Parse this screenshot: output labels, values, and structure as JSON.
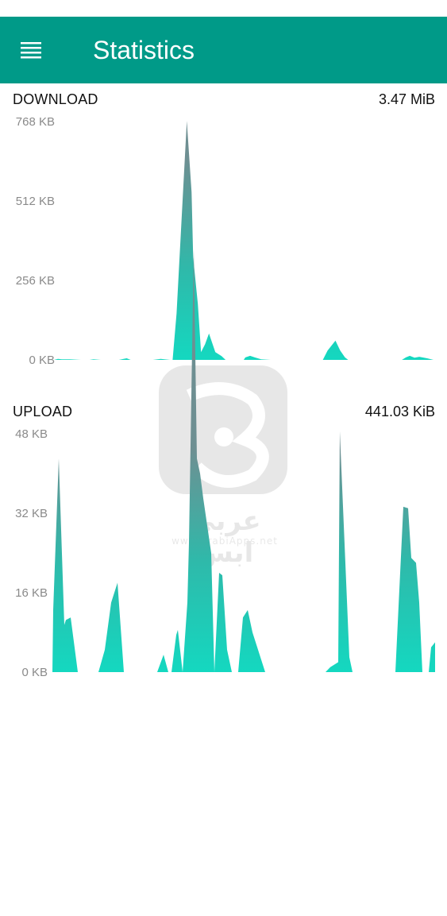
{
  "header": {
    "title": "Statistics",
    "menu_icon": "hamburger-menu-icon",
    "background": "#009a88"
  },
  "download": {
    "label": "DOWNLOAD",
    "total": "3.47 MiB",
    "y_ticks": [
      "768 KB",
      "512 KB",
      "256 KB",
      "0 KB"
    ]
  },
  "upload": {
    "label": "UPLOAD",
    "total": "441.03 KiB",
    "y_ticks": [
      "48 KB",
      "32 KB",
      "16 KB",
      "0 KB"
    ]
  },
  "watermark": {
    "text": "عربي ابس",
    "url": "www.ArabiApps.net"
  },
  "chart_data": [
    {
      "type": "area",
      "name_ref": "download",
      "ylim": [
        0,
        768
      ],
      "y_unit": "KB",
      "x": [
        0,
        5,
        10,
        20,
        34,
        45,
        50,
        59,
        82,
        88,
        92,
        97,
        118,
        125,
        135,
        147,
        150,
        155,
        168,
        174,
        176,
        182,
        186,
        191,
        196,
        204,
        212,
        217,
        240,
        242,
        248,
        254,
        262,
        274,
        340,
        346,
        356,
        362,
        368,
        372,
        440,
        445,
        450,
        456,
        462,
        472,
        480
      ],
      "values": [
        0,
        3,
        2,
        2,
        0,
        0,
        2,
        0,
        0,
        3,
        5,
        0,
        0,
        0,
        3,
        0,
        0,
        150,
        770,
        540,
        330,
        180,
        25,
        50,
        85,
        25,
        12,
        0,
        0,
        8,
        13,
        8,
        2,
        0,
        0,
        30,
        62,
        30,
        8,
        0,
        0,
        8,
        13,
        7,
        10,
        5,
        0
      ]
    },
    {
      "type": "area",
      "name_ref": "upload",
      "ylim": [
        0,
        48
      ],
      "y_unit": "KB",
      "x": [
        0,
        1,
        8,
        15,
        17,
        23,
        32,
        58,
        66,
        74,
        82,
        90,
        132,
        140,
        146,
        150,
        156,
        158,
        164,
        170,
        172,
        178,
        182,
        186,
        190,
        200,
        204,
        210,
        214,
        220,
        226,
        230,
        234,
        240,
        246,
        252,
        268,
        344,
        350,
        360,
        362,
        374,
        378,
        432,
        442,
        448,
        452,
        458,
        462,
        466,
        474,
        477,
        482
      ],
      "values": [
        0,
        12.5,
        43,
        9.5,
        10.5,
        11,
        0,
        0,
        4.5,
        14,
        18,
        0,
        0,
        3.5,
        0,
        0,
        7.5,
        8.5,
        0,
        14,
        26,
        85,
        43,
        40,
        35,
        24,
        0,
        20,
        19.5,
        4.5,
        0,
        0,
        0,
        11,
        12.5,
        8,
        0,
        0,
        1,
        2,
        48.5,
        3,
        0,
        0,
        33.3,
        33,
        23,
        22,
        14,
        0,
        0,
        5,
        6
      ]
    }
  ]
}
